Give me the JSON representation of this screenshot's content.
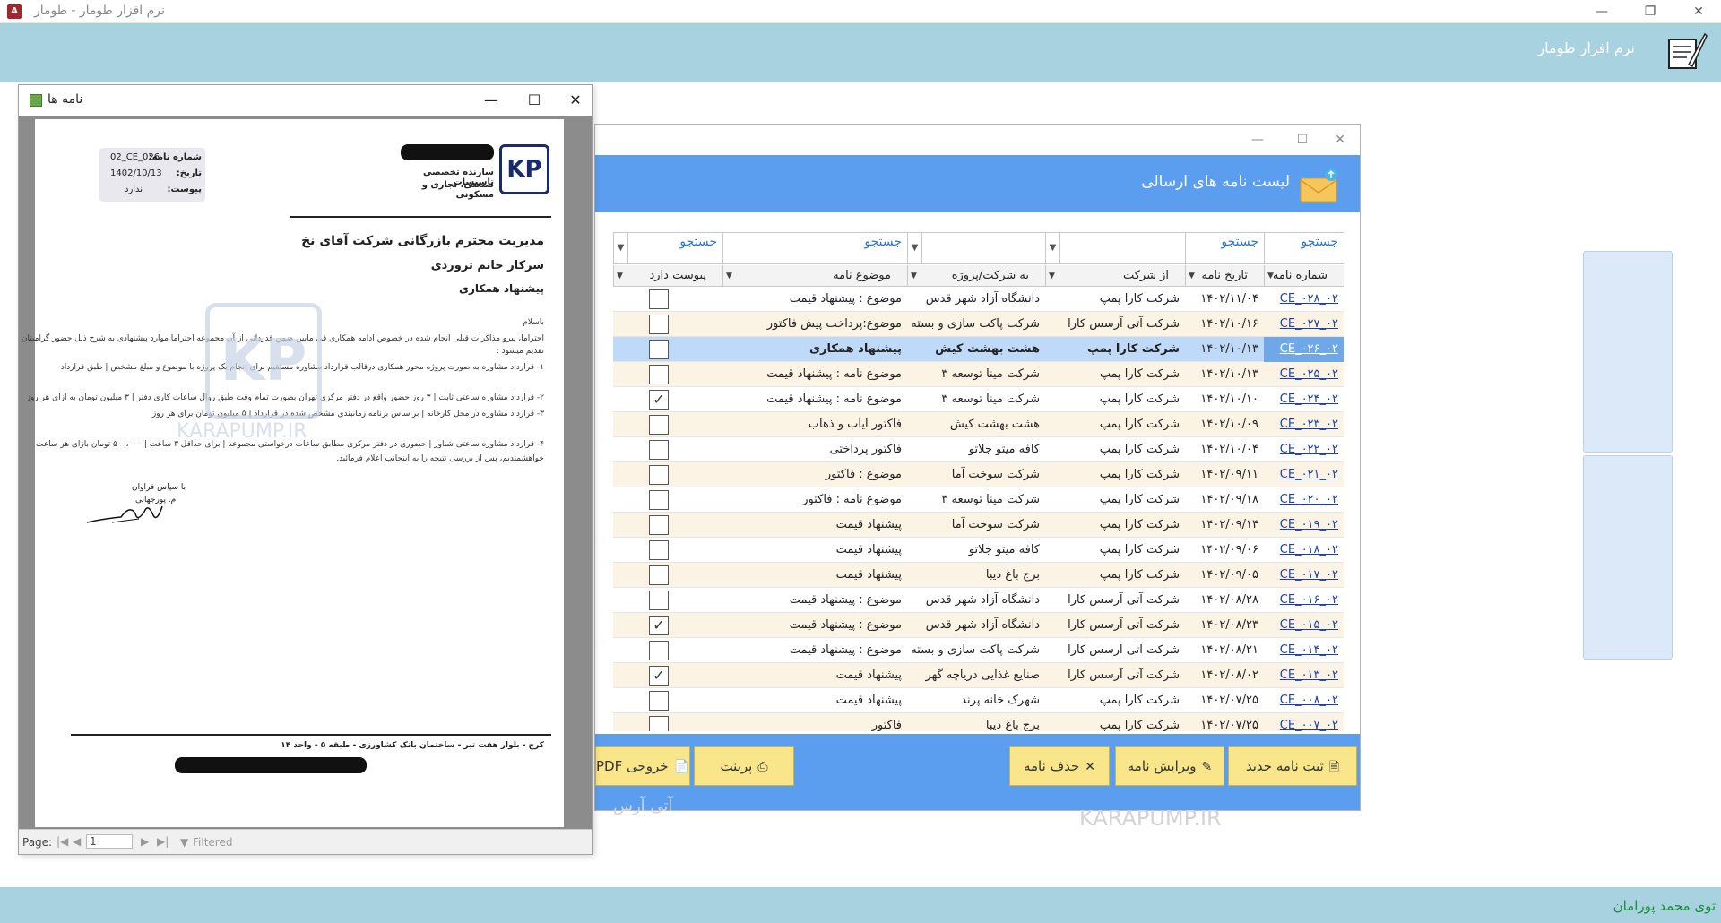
{
  "app": {
    "window_title": "نرم افزار طومار - طومار",
    "name": "نرم افزار طومار",
    "user": "توی محمد پورامان"
  },
  "list_window": {
    "title": "لیست نامه های ارسالی",
    "search_placeholder": "جستجو",
    "columns": [
      "شماره نامه",
      "تاریخ نامه",
      "از شرکت",
      "به شرکت/پروژه",
      "موضوع نامه",
      "پیوست دارد"
    ],
    "rows": [
      {
        "num": "۰۲_CE_۰۲۸",
        "date": "۱۴۰۲/۱۱/۰۴",
        "from": "شرکت کارا پمپ",
        "to": "دانشگاه آزاد شهر قدس",
        "subject": "موضوع : پیشنهاد قیمت",
        "attach": false
      },
      {
        "num": "۰۲_CE_۰۲۷",
        "date": "۱۴۰۲/۱۰/۱۶",
        "from": "شرکت آتی آرسس کارا",
        "to": "شرکت پاکت سازی و بسته بن",
        "subject": "موضوع:پرداخت پیش فاکتور",
        "attach": false
      },
      {
        "num": "۰۲_CE_۰۲۶",
        "date": "۱۴۰۲/۱۰/۱۳",
        "from": "شرکت کارا پمپ",
        "to": "هشت بهشت کیش",
        "subject": "پیشنهاد همکاری",
        "attach": false
      },
      {
        "num": "۰۲_CE_۰۲۵",
        "date": "۱۴۰۲/۱۰/۱۳",
        "from": "شرکت کارا پمپ",
        "to": "شرکت مینا توسعه ۳",
        "subject": "موضوع نامه : پیشنهاد قیمت",
        "attach": false
      },
      {
        "num": "۰۲_CE_۰۲۴",
        "date": "۱۴۰۲/۱۰/۱۰",
        "from": "شرکت کارا پمپ",
        "to": "شرکت مینا توسعه ۳",
        "subject": "موضوع نامه : پیشنهاد قیمت",
        "attach": true
      },
      {
        "num": "۰۲_CE_۰۲۳",
        "date": "۱۴۰۲/۱۰/۰۹",
        "from": "شرکت کارا پمپ",
        "to": "هشت بهشت کیش",
        "subject": "فاکتور ایاب و ذهاب",
        "attach": false
      },
      {
        "num": "۰۲_CE_۰۲۲",
        "date": "۱۴۰۲/۱۰/۰۴",
        "from": "شرکت کارا پمپ",
        "to": "کافه میتو جلاتو",
        "subject": "فاکتور پرداختی",
        "attach": false
      },
      {
        "num": "۰۲_CE_۰۲۱",
        "date": "۱۴۰۲/۰۹/۱۱",
        "from": "شرکت کارا پمپ",
        "to": "شرکت سوخت آما",
        "subject": "موضوع : فاکتور",
        "attach": false
      },
      {
        "num": "۰۲_CE_۰۲۰",
        "date": "۱۴۰۲/۰۹/۱۸",
        "from": "شرکت کارا پمپ",
        "to": "شرکت مینا توسعه ۳",
        "subject": "موضوع نامه : فاکتور",
        "attach": false
      },
      {
        "num": "۰۲_CE_۰۱۹",
        "date": "۱۴۰۲/۰۹/۱۴",
        "from": "شرکت کارا پمپ",
        "to": "شرکت سوخت آما",
        "subject": "پیشنهاد قیمت",
        "attach": false
      },
      {
        "num": "۰۲_CE_۰۱۸",
        "date": "۱۴۰۲/۰۹/۰۶",
        "from": "شرکت کارا پمپ",
        "to": "کافه میتو جلاتو",
        "subject": "پیشنهاد قیمت",
        "attach": false
      },
      {
        "num": "۰۲_CE_۰۱۷",
        "date": "۱۴۰۲/۰۹/۰۵",
        "from": "شرکت کارا پمپ",
        "to": "برج باغ دیبا",
        "subject": "پیشنهاد قیمت",
        "attach": false
      },
      {
        "num": "۰۲_CE_۰۱۶",
        "date": "۱۴۰۲/۰۸/۲۸",
        "from": "شرکت آتی آرسس کارا",
        "to": "دانشگاه آزاد شهر قدس",
        "subject": "موضوع : پیشنهاد قیمت",
        "attach": false
      },
      {
        "num": "۰۲_CE_۰۱۵",
        "date": "۱۴۰۲/۰۸/۲۳",
        "from": "شرکت آتی آرسس کارا",
        "to": "دانشگاه آزاد شهر قدس",
        "subject": "موضوع : پیشنهاد قیمت",
        "attach": true
      },
      {
        "num": "۰۲_CE_۰۱۴",
        "date": "۱۴۰۲/۰۸/۲۱",
        "from": "شرکت آتی آرسس کارا",
        "to": "شرکت پاکت سازی و بسته بن",
        "subject": "موضوع : پیشنهاد قیمت",
        "attach": false
      },
      {
        "num": "۰۲_CE_۰۱۳",
        "date": "۱۴۰۲/۰۸/۰۲",
        "from": "شرکت آتی آرسس کارا",
        "to": "صنایع غذایی دریاچه گهر",
        "subject": "پیشنهاد قیمت",
        "attach": true
      },
      {
        "num": "۰۲_CE_۰۰۸",
        "date": "۱۴۰۲/۰۷/۲۵",
        "from": "شرکت کارا پمپ",
        "to": "شهرک خانه پرند",
        "subject": "پیشنهاد قیمت",
        "attach": false
      },
      {
        "num": "۰۲_CE_۰۰۷",
        "date": "۱۴۰۲/۰۷/۲۵",
        "from": "شرکت کارا پمپ",
        "to": "برج باغ دیبا",
        "subject": "فاکتور",
        "attach": false
      }
    ],
    "selected_row": 2,
    "buttons": {
      "new": "ثبت نامه جدید",
      "edit": "ویرایش نامه",
      "delete": "حذف نامه",
      "print": "پرینت",
      "pdf": "خروجی PDF"
    },
    "watermark": "KARAPUMP.IR",
    "ghost_text": "آتی آرس"
  },
  "preview_window": {
    "title": "نامه ها",
    "letter_info": {
      "number_label": "شماره نامه:",
      "number": "02_CE_026",
      "date_label": "تاریخ:",
      "date": "1402/10/13",
      "attach_label": "پیوست:",
      "attach": "ندارد"
    },
    "company_line1": "سازنده تخصصی تاسیسات",
    "company_line2": "صنعتی، تجاری و مسکونی",
    "logo_text": "KP",
    "recipient": "مدیریت محترم بازرگانی شرکت آقای نخ",
    "salutation": "سرکار خانم تروردی",
    "subject": "پیشنهاد همکاری",
    "greeting": "باسلام",
    "body": [
      "احتراما، پیرو مذاکرات قبلی انجام شده در خصوص ادامه همکاری فی مابین ضمن قدردانی از آن مجموعه احتراما موارد پیشنهادی به شرح ذیل حضور گرامیتان",
      "تقدیم میشود :",
      "۱- قرارداد مشاوره به صورت پروژه محور همکاری درقالب قرارداد مشاوره مستقیم برای انجام یک پروژه با موضوع و مبلغ مشخص | طبق قرارداد",
      "۲- قرارداد مشاوره ساعتی ثابت | ۳ روز حضور واقع در دفتر مرکزی تهران بصورت تمام وقت طبق روال ساعات کاری دفتر | ۳ میلیون تومان به ازای هر روز",
      "۳- قرارداد مشاوره در محل کارخانه | براساس برنامه زمانبندی مشخص شده در قرارداد | ۵ میلیون تومان برای هر روز",
      "۴- قرارداد مشاوره ساعتی شناور | حضوری در دفتر مرکزی مطابق ساعات درخواستی مجموعه | برای حداقل ۳ ساعت | ۵۰۰،۰۰۰ تومان بازای هر ساعت",
      "خواهشمندیم، پس از بررسی نتیجه را به اینجانب اعلام فرمائید."
    ],
    "closing": "با سپاس فراوان",
    "signer": "م. پورجهانی",
    "address": "کرج - بلوار هفت تیر - ساختمان بانک کشاورزی - طبقه ۵ - واحد ۱۴",
    "watermark": "KARAPUMP.IR",
    "footer": {
      "page_label": "Page:",
      "page_value": "1",
      "filter": "Filtered"
    }
  }
}
